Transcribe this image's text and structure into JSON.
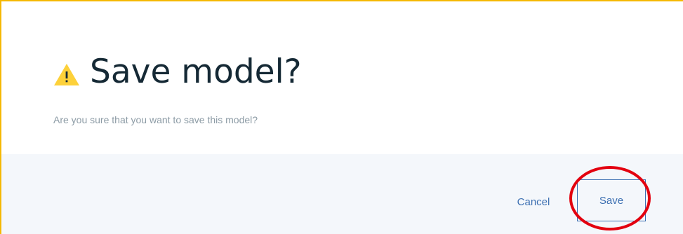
{
  "dialog": {
    "title": "Save model?",
    "message": "Are you sure that you want to save this model?",
    "warning_icon": "warning-triangle-icon",
    "cancel_label": "Cancel",
    "save_label": "Save"
  },
  "colors": {
    "title": "#152935",
    "message": "#8c9ba5",
    "link_blue": "#3d70b2",
    "footer_bg": "#f4f7fb",
    "warning_yellow": "#fdd13a",
    "frame_border": "#f5b800",
    "annotation_red": "#e3000f"
  }
}
